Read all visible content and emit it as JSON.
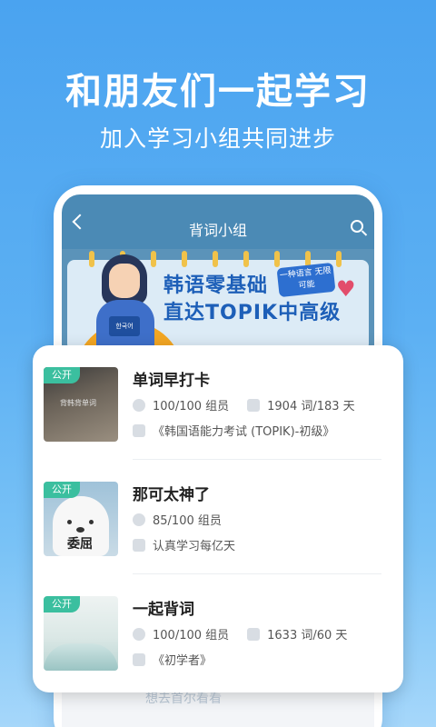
{
  "hero": {
    "title": "和朋友们一起学习",
    "subtitle": "加入学习小组共同进步"
  },
  "app": {
    "title": "背词小组",
    "back_icon": "chevron-left-icon",
    "search_icon": "search-icon"
  },
  "banner": {
    "line1": "韩语零基础",
    "line2": "直达TOPIK中高级",
    "tag": "一种语言 无限可能",
    "book_label": "한국어"
  },
  "groups": [
    {
      "badge": "公开",
      "name": "单词早打卡",
      "members": "100/100 组员",
      "progress": "1904 词/183 天",
      "book": "《韩国语能力考试 (TOPIK)-初级》",
      "thumb_text": "背韩背单词"
    },
    {
      "badge": "公开",
      "name": "那可太神了",
      "members": "85/100 组员",
      "book": "认真学习每亿天",
      "thumb_text": "委屈"
    },
    {
      "badge": "公开",
      "name": "一起背词",
      "members": "100/100 组员",
      "progress": "1633 词/60 天",
      "book": "《初学者》"
    }
  ],
  "ghost_text": "想去首尔看看",
  "colors": {
    "background_top": "#4aa3f0",
    "appbar": "#4b8ab5",
    "badge": "#3bbf9f"
  }
}
